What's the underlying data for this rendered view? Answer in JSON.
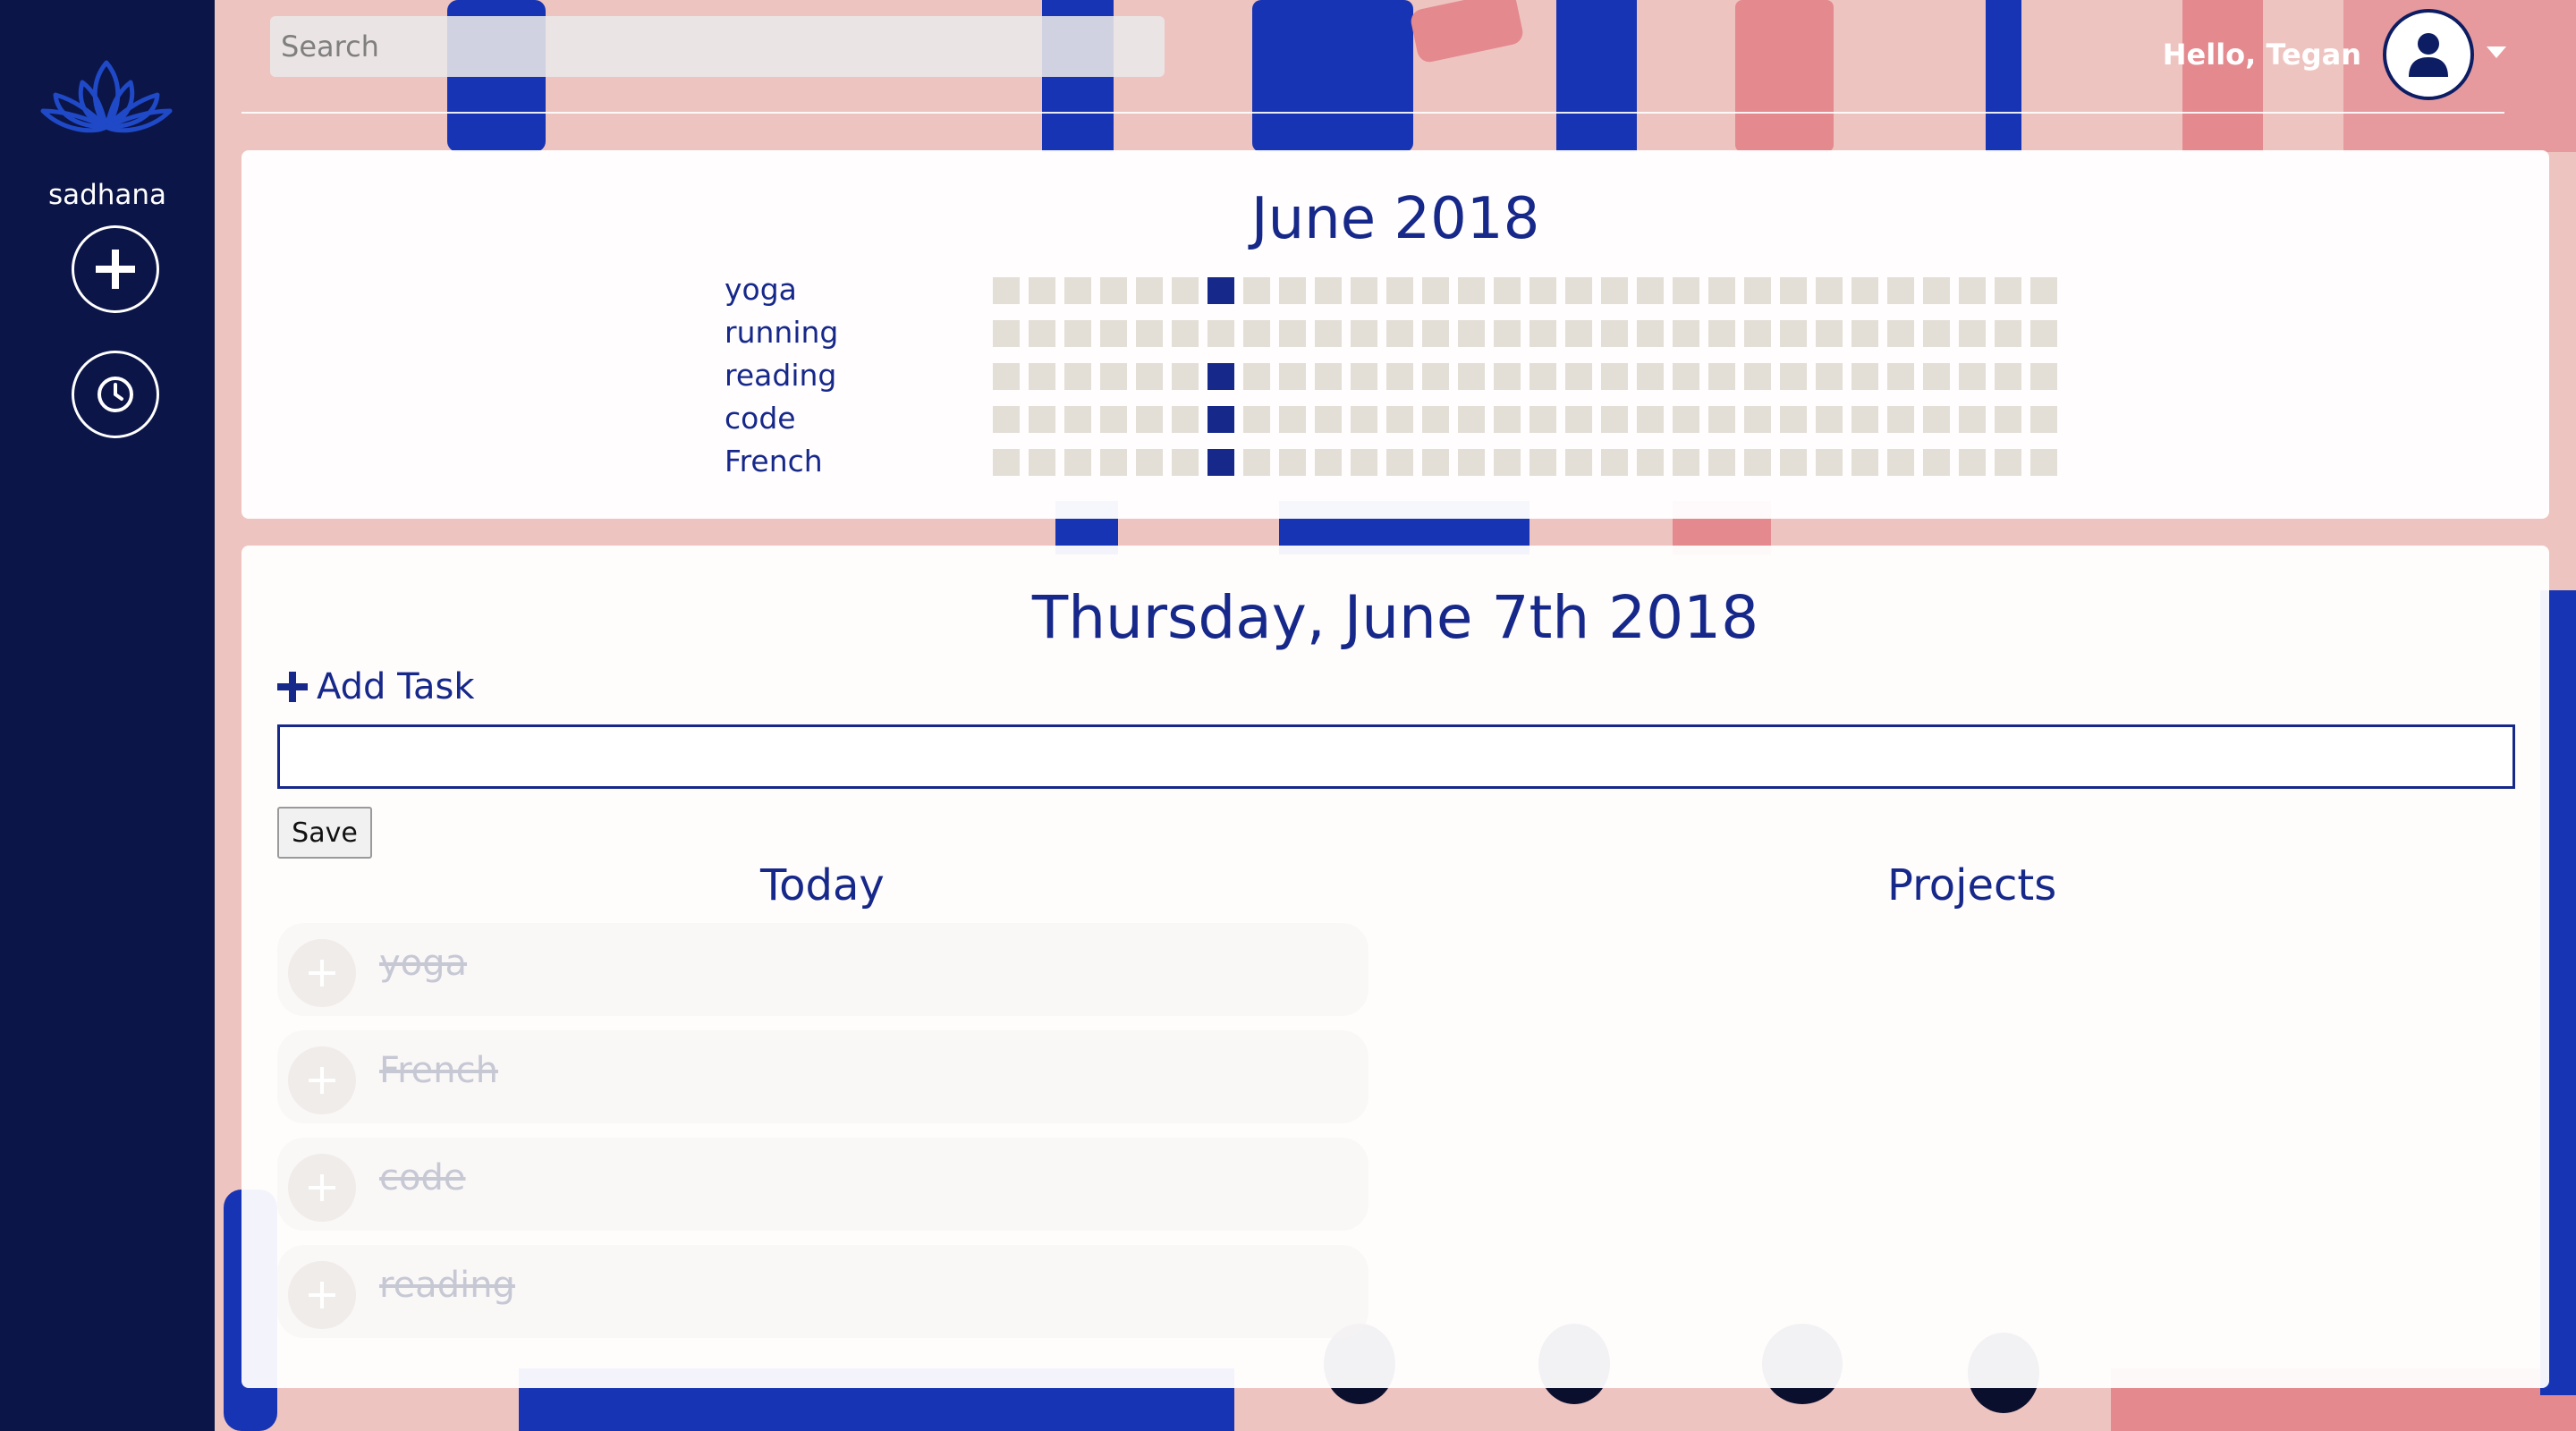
{
  "sidebar": {
    "brand": "sadhana",
    "logo_icon": "lotus-icon",
    "buttons": [
      {
        "icon": "plus-icon"
      },
      {
        "icon": "clock-icon"
      }
    ]
  },
  "header": {
    "search": {
      "placeholder": "Search",
      "value": ""
    },
    "greeting": "Hello, Tegan",
    "avatar_icon": "user-icon",
    "menu_icon": "caret-down-icon"
  },
  "calendar": {
    "title": "June 2018",
    "days_in_month": 30,
    "habits": [
      {
        "name": "yoga",
        "done_days": [
          7
        ]
      },
      {
        "name": "running",
        "done_days": []
      },
      {
        "name": "reading",
        "done_days": [
          7
        ]
      },
      {
        "name": "code",
        "done_days": [
          7
        ]
      },
      {
        "name": "French",
        "done_days": [
          7
        ]
      }
    ]
  },
  "day": {
    "title": "Thursday, June 7th 2018",
    "add_task_label": "Add Task",
    "task_input": {
      "value": ""
    },
    "save_label": "Save",
    "today_title": "Today",
    "projects_title": "Projects",
    "tasks": [
      {
        "name": "yoga",
        "completed": true
      },
      {
        "name": "French",
        "completed": true
      },
      {
        "name": "code",
        "completed": true
      },
      {
        "name": "reading",
        "completed": true
      }
    ]
  },
  "colors": {
    "sidebar": "#0b1547",
    "accent": "#16288a",
    "empty_cell": "#e3ded6",
    "background": "#e9a6a7"
  }
}
